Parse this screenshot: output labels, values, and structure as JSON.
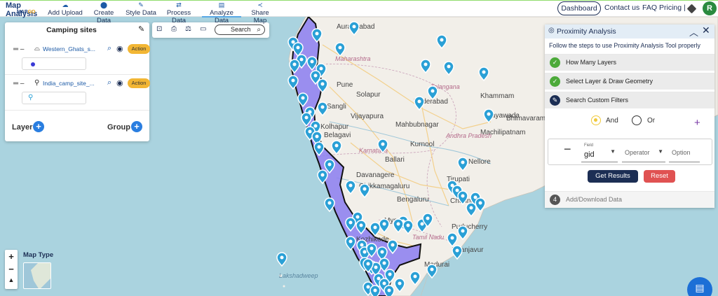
{
  "app": {
    "title": "Map Analysis",
    "logo_prefix": "MAP",
    "logo_suffix": "GO"
  },
  "nav": {
    "items": [
      {
        "label": "Add Upload",
        "icon": "cloud-upload-icon"
      },
      {
        "label": "Create Data",
        "icon": "pin-icon"
      },
      {
        "label": "Style Data",
        "icon": "paint-icon"
      },
      {
        "label": "Process Data",
        "icon": "process-icon"
      },
      {
        "label": "Analyze Data",
        "icon": "analyze-icon",
        "active": true
      },
      {
        "label": "Share Map",
        "icon": "share-icon"
      }
    ],
    "dashboard": "Dashboard",
    "contact": "Contact us",
    "faq": "FAQ",
    "pricing": "Pricing |",
    "avatar": "R"
  },
  "layers_panel": {
    "title": "Camping sites",
    "layers": [
      {
        "name": "Western_Ghats_s...",
        "type_icon": "polygon-icon",
        "action": "Action",
        "legend": "polygon-fill"
      },
      {
        "name": "India_camp_site_...",
        "type_icon": "pin-icon",
        "action": "Action",
        "legend": "pin-marker"
      }
    ],
    "layer_label": "Layer",
    "group_label": "Group"
  },
  "map_toolbar": {
    "search_label": "Search"
  },
  "proximity": {
    "title": "Proximity Analysis",
    "subtitle": "Follow the steps to use Proximity Analysis Tool properly",
    "steps": [
      {
        "label": "How Many Layers",
        "status": "done"
      },
      {
        "label": "Select Layer & Draw Geometry",
        "status": "done"
      },
      {
        "label": "Search Custom Filters",
        "status": "active"
      },
      {
        "label": "Add/Download Data",
        "status": "pending",
        "number": "4"
      }
    ],
    "logic": {
      "and_label": "And",
      "or_label": "Or",
      "selected": "And"
    },
    "filter": {
      "field_caption": "Field",
      "field_value": "gid",
      "operator_placeholder": "Operator",
      "option_placeholder": "Option"
    },
    "get_results": "Get Results",
    "reset": "Reset"
  },
  "map": {
    "map_type_label": "Map Type",
    "colors": {
      "sea": "#aad3df",
      "land": "#f2efe9",
      "polygon_fill": "#8b7cf0",
      "polygon_stroke": "#111111",
      "marker": "#2aa0d6"
    },
    "places": [
      {
        "name": "Aurangabad",
        "kind": "city"
      },
      {
        "name": "Maharashtra",
        "kind": "state"
      },
      {
        "name": "Pune",
        "kind": "city"
      },
      {
        "name": "Solapur",
        "kind": "city"
      },
      {
        "name": "Sangli",
        "kind": "city"
      },
      {
        "name": "Vijayapura",
        "kind": "city"
      },
      {
        "name": "Kolhapur",
        "kind": "city"
      },
      {
        "name": "Belagavi",
        "kind": "city"
      },
      {
        "name": "Telangana",
        "kind": "state"
      },
      {
        "name": "Khammam",
        "kind": "city"
      },
      {
        "name": "Hyderabad",
        "kind": "city"
      },
      {
        "name": "Mahbubnagar",
        "kind": "city"
      },
      {
        "name": "Vijayawada",
        "kind": "city"
      },
      {
        "name": "Bhimavaram",
        "kind": "city"
      },
      {
        "name": "Machilipatnam",
        "kind": "city"
      },
      {
        "name": "Kurnool",
        "kind": "city"
      },
      {
        "name": "Andhra Pradesh",
        "kind": "state"
      },
      {
        "name": "Karnataka",
        "kind": "state"
      },
      {
        "name": "Ballari",
        "kind": "city"
      },
      {
        "name": "Nellore",
        "kind": "city"
      },
      {
        "name": "Davanagere",
        "kind": "city"
      },
      {
        "name": "Tirupati",
        "kind": "city"
      },
      {
        "name": "Chikkamagaluru",
        "kind": "city"
      },
      {
        "name": "Bengaluru",
        "kind": "city"
      },
      {
        "name": "Chennai",
        "kind": "city"
      },
      {
        "name": "Mysuru",
        "kind": "city"
      },
      {
        "name": "Kozhikode",
        "kind": "city"
      },
      {
        "name": "Puducherry",
        "kind": "city"
      },
      {
        "name": "Tamil Nadu",
        "kind": "state"
      },
      {
        "name": "Thanjavur",
        "kind": "city"
      },
      {
        "name": "Madurai",
        "kind": "city"
      },
      {
        "name": "Lakshadweep",
        "kind": "sea"
      }
    ]
  }
}
